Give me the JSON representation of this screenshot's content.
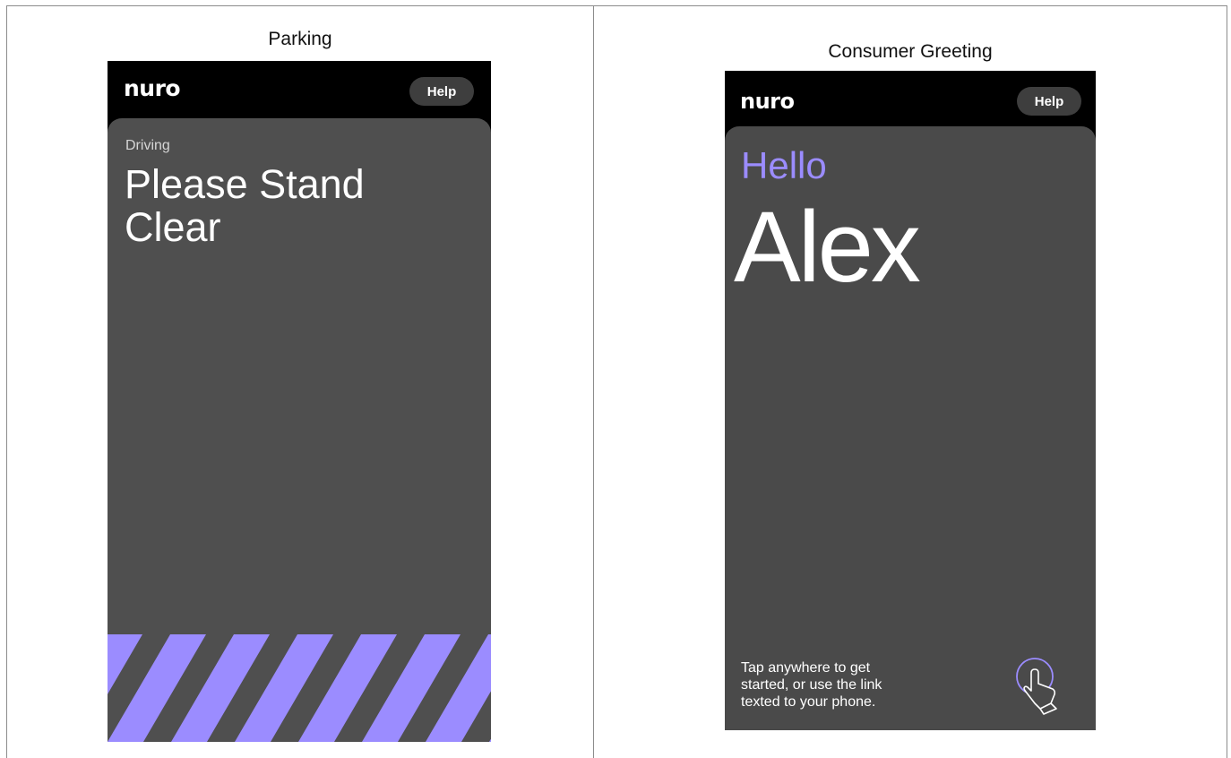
{
  "screens": [
    {
      "caption": "Parking",
      "logo": "nuro",
      "help_label": "Help",
      "status": "Driving",
      "headline_line1": "Please Stand",
      "headline_line2": "Clear"
    },
    {
      "caption": "Consumer Greeting",
      "logo": "nuro",
      "help_label": "Help",
      "greeting": "Hello",
      "name": "Alex",
      "instruction_line1": "Tap anywhere to get",
      "instruction_line2": "started, or use the link",
      "instruction_line3": "texted to your phone.",
      "icon": "tap-hand-icon"
    }
  ],
  "colors": {
    "accent": "#9b8cff",
    "card": "#4f4f4f",
    "header": "#000000",
    "help_button": "#3e3e3e"
  }
}
